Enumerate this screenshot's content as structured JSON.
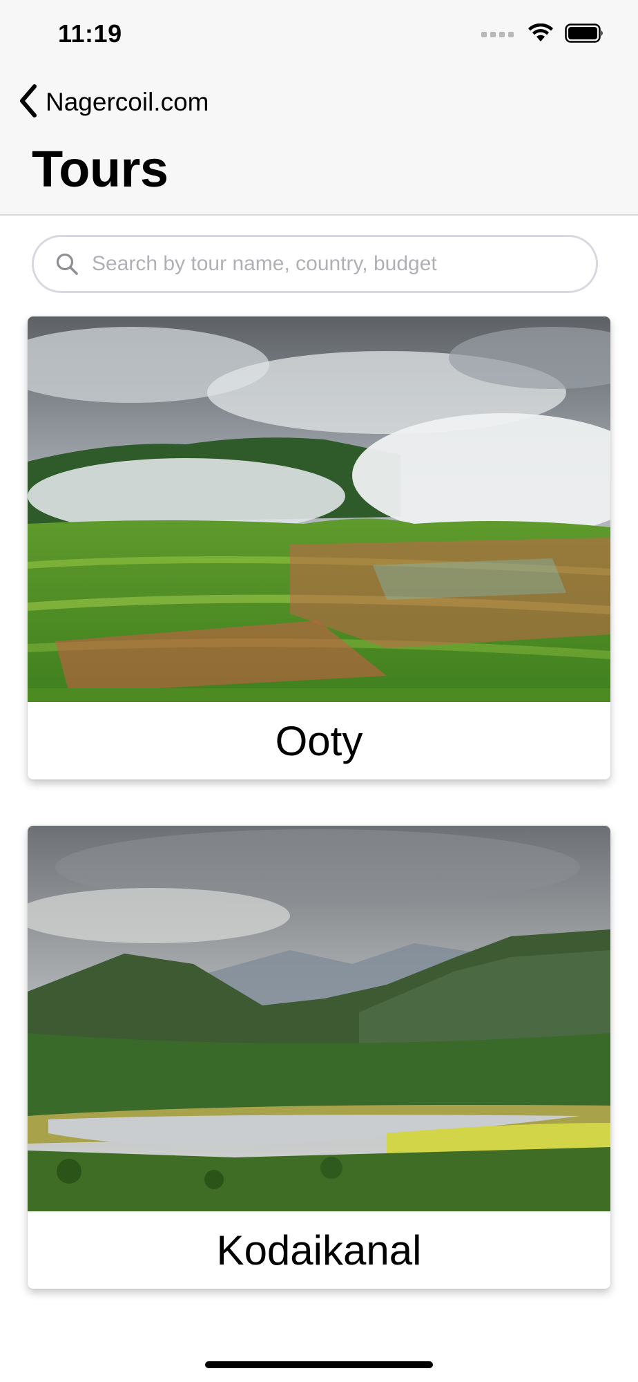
{
  "status_bar": {
    "time": "11:19"
  },
  "nav": {
    "back_label": "Nagercoil.com",
    "title": "Tours"
  },
  "search": {
    "placeholder": "Search by tour name, country, budget",
    "value": ""
  },
  "tours": [
    {
      "name": "Ooty",
      "image": "ooty-hill-village-photo"
    },
    {
      "name": "Kodaikanal",
      "image": "kodaikanal-mountain-lake-photo"
    }
  ],
  "colors": {
    "nav_background": "#f7f7f7",
    "search_border": "#d8d8e0",
    "placeholder": "#b0b0b6",
    "text": "#000000"
  }
}
